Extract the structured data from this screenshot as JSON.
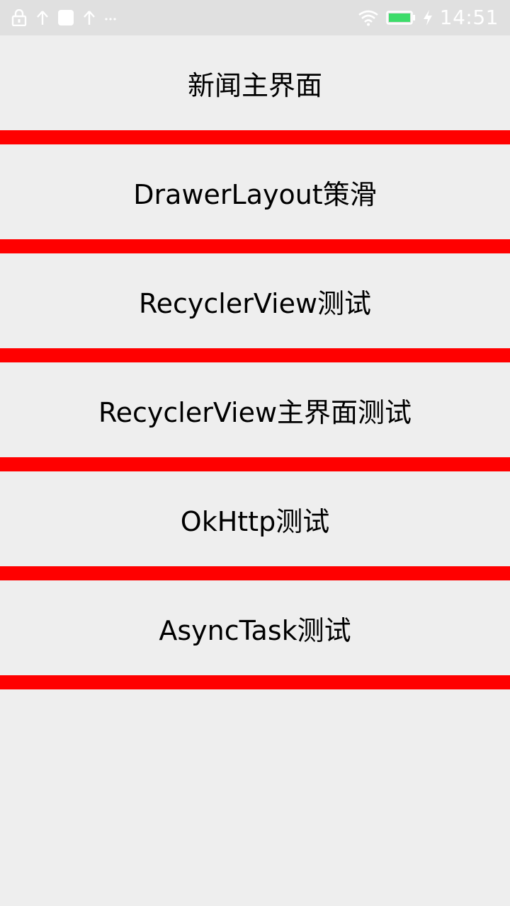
{
  "status_bar": {
    "time": "14:51",
    "left_icons": [
      "lock-icon",
      "upload-arrow-icon",
      "square-notification-icon",
      "upload-arrow-icon",
      "more-dots-icon"
    ],
    "right_icons": [
      "wifi-icon",
      "battery-icon",
      "charging-bolt-icon"
    ],
    "battery_color": "#3ddc6a"
  },
  "colors": {
    "background": "#eeeeee",
    "divider": "#ff0000",
    "status_bar": "#e0e0e0",
    "text": "#000000"
  },
  "menu": {
    "items": [
      {
        "label": "新闻主界面"
      },
      {
        "label": "DrawerLayout策滑"
      },
      {
        "label": "RecyclerView测试"
      },
      {
        "label": "RecyclerView主界面测试"
      },
      {
        "label": "OkHttp测试"
      },
      {
        "label": "AsyncTask测试"
      }
    ]
  }
}
